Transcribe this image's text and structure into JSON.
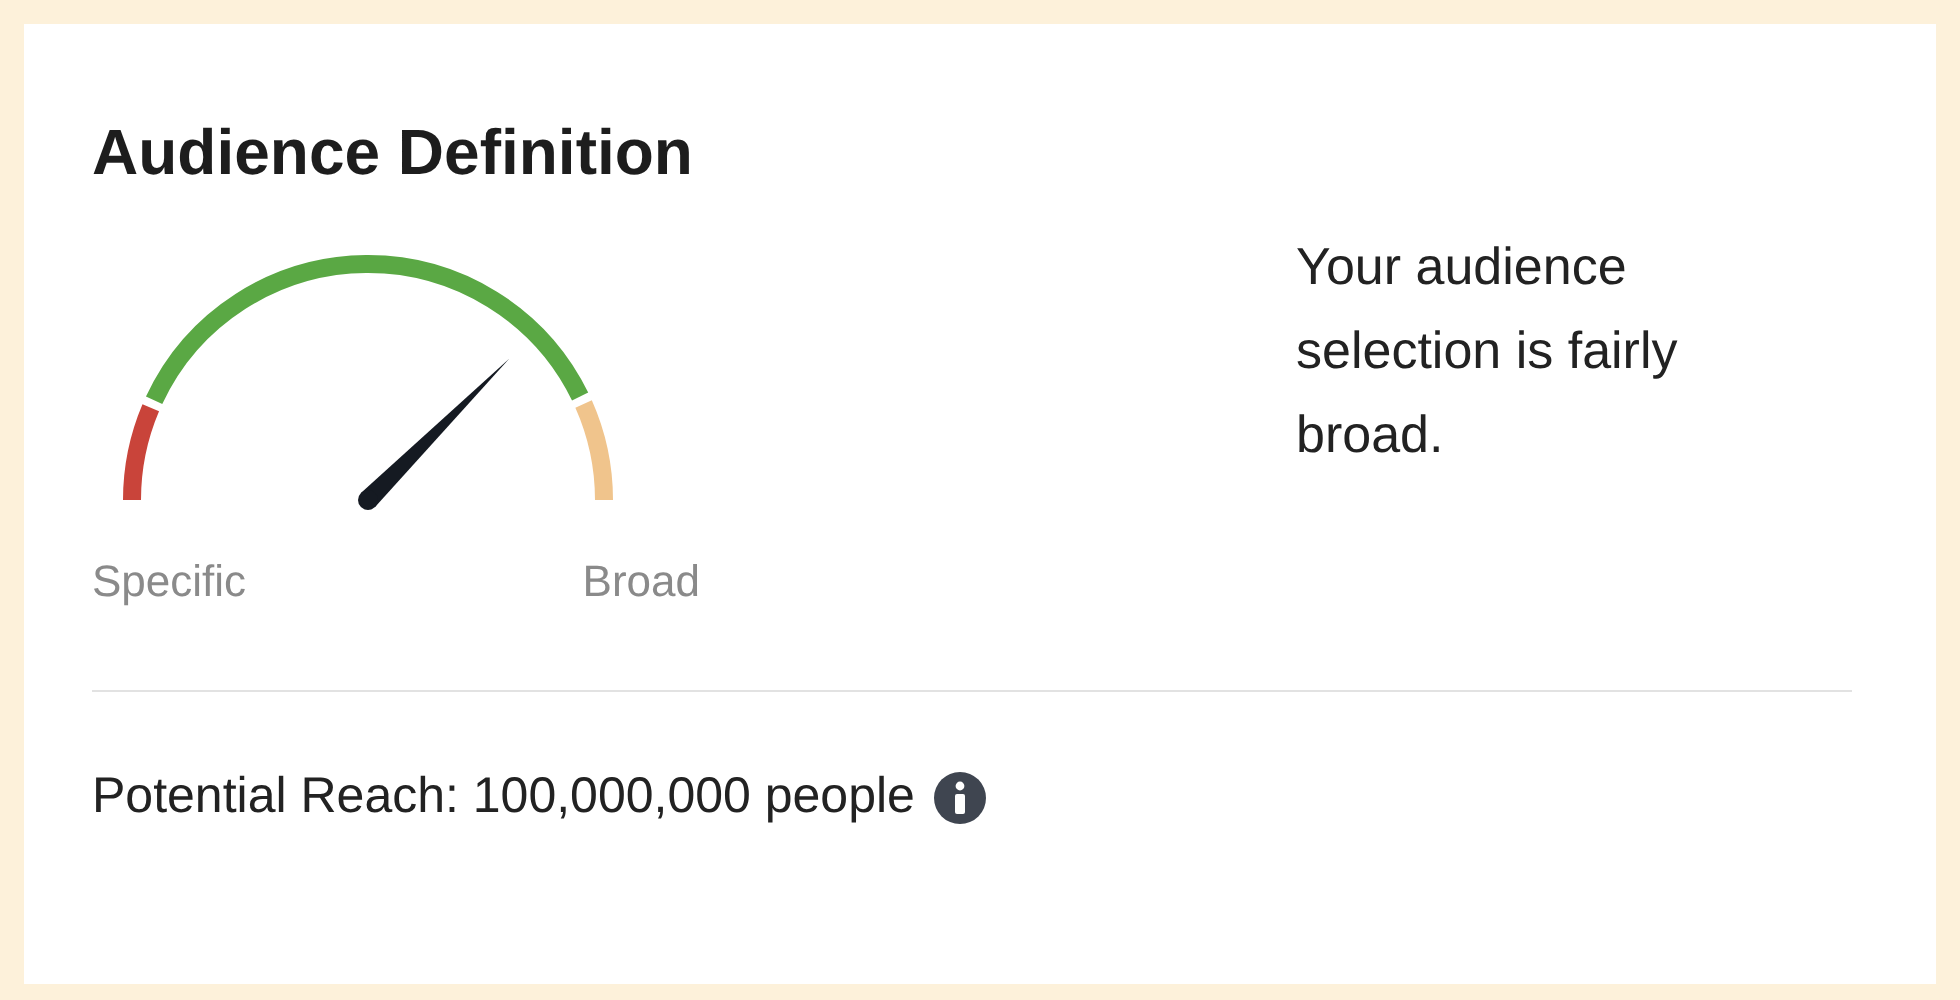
{
  "title": "Audience Definition",
  "gauge": {
    "min_label": "Specific",
    "max_label": "Broad"
  },
  "description": "Your audience selection is fairly broad.",
  "potential_reach": "Potential Reach: 100,000,000 people"
}
